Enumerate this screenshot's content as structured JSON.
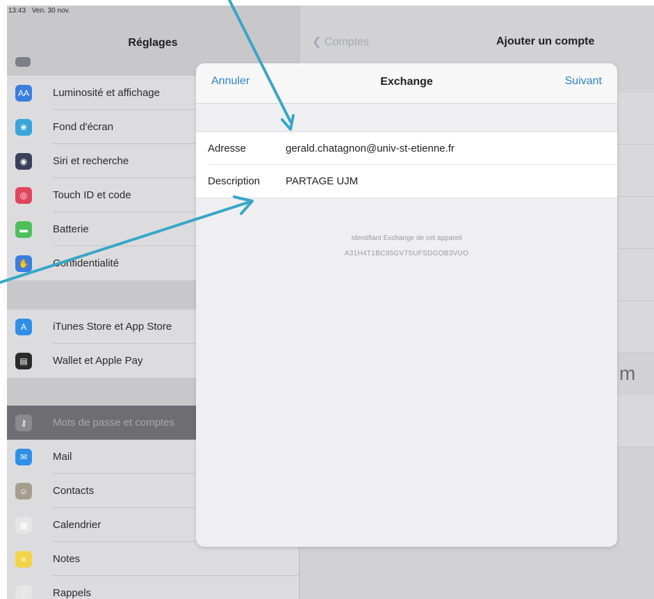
{
  "status_bar": {
    "time": "13:43",
    "date": "Ven. 30 nov."
  },
  "settings": {
    "title": "Réglages",
    "group1": [
      {
        "label": "Luminosité et affichage",
        "icon": "brightness-icon",
        "glyph": "AA",
        "color": "#3b7de0"
      },
      {
        "label": "Fond d'écran",
        "icon": "wallpaper-icon",
        "glyph": "❀",
        "color": "#3aa6d8"
      },
      {
        "label": "Siri et recherche",
        "icon": "siri-icon",
        "glyph": "◉",
        "color": "#3a3f5a"
      },
      {
        "label": "Touch ID et code",
        "icon": "fingerprint-icon",
        "glyph": "◎",
        "color": "#e0465b"
      },
      {
        "label": "Batterie",
        "icon": "battery-icon",
        "glyph": "▬",
        "color": "#4cc05a"
      },
      {
        "label": "Confidentialité",
        "icon": "hand-icon",
        "glyph": "✋",
        "color": "#3b7de0"
      }
    ],
    "group2": [
      {
        "label": "iTunes Store et App Store",
        "icon": "app-store-icon",
        "glyph": "A",
        "color": "#2f8fe8"
      },
      {
        "label": "Wallet et Apple Pay",
        "icon": "wallet-icon",
        "glyph": "▤",
        "color": "#2a2a2a"
      }
    ],
    "group3": [
      {
        "label": "Mots de passe et comptes",
        "icon": "key-icon",
        "glyph": "⚷",
        "color": "#8a8a8f",
        "selected": true
      },
      {
        "label": "Mail",
        "icon": "mail-icon",
        "glyph": "✉",
        "color": "#2f8fe8"
      },
      {
        "label": "Contacts",
        "icon": "contacts-icon",
        "glyph": "☺",
        "color": "#a59d8e"
      },
      {
        "label": "Calendrier",
        "icon": "calendar-icon",
        "glyph": "▦",
        "color": "#e6e6e6"
      },
      {
        "label": "Notes",
        "icon": "notes-icon",
        "glyph": "≡",
        "color": "#f3d34a"
      },
      {
        "label": "Rappels",
        "icon": "reminders-icon",
        "glyph": "⋮",
        "color": "#e6e6e6"
      }
    ]
  },
  "right_pane": {
    "back_label": "Comptes",
    "title": "Ajouter un compte",
    "partial_text": "m"
  },
  "modal": {
    "cancel_label": "Annuler",
    "title": "Exchange",
    "next_label": "Suivant",
    "fields": [
      {
        "label": "Adresse",
        "value": "gerald.chatagnon@univ-st-etienne.fr"
      },
      {
        "label": "Description",
        "value": "PARTAGE UJM"
      }
    ],
    "device_label": "Identifiant Exchange de cet appareil",
    "device_id": "A31H4T1BC95GV7SUFSDGOB3VUO"
  },
  "colors": {
    "accent": "#2f84c6",
    "arrow": "#37a6c8"
  }
}
